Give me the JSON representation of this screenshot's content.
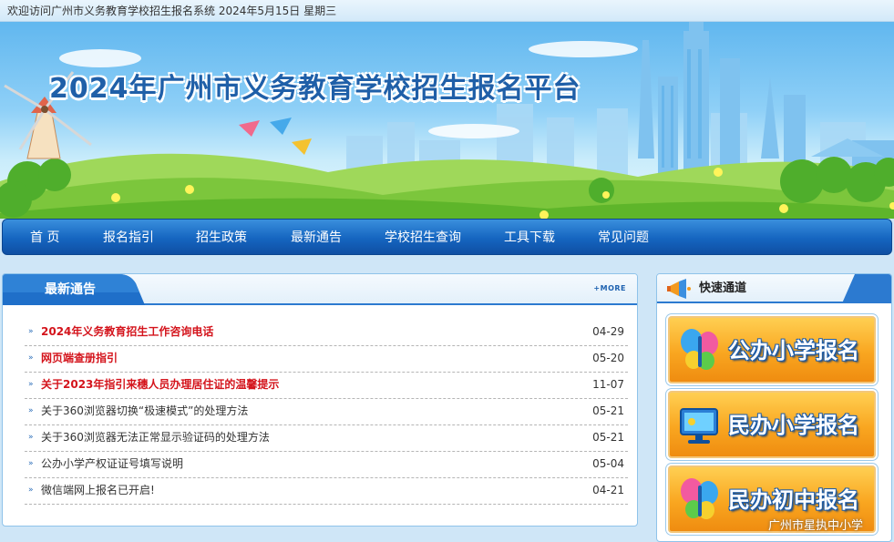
{
  "topbar": {
    "welcome": "欢迎访问广州市义务教育学校招生报名系统",
    "date": "2024年5月15日",
    "weekday": "星期三"
  },
  "banner": {
    "title": "2024年广州市义务教育学校招生报名平台"
  },
  "nav": {
    "items": [
      "首 页",
      "报名指引",
      "招生政策",
      "最新通告",
      "学校招生查询",
      "工具下载",
      "常见问题"
    ]
  },
  "news": {
    "title": "最新通告",
    "more": "+MORE",
    "items": [
      {
        "title": "2024年义务教育招生工作咨询电话",
        "date": "04-29",
        "highlight": true
      },
      {
        "title": "网页端查册指引",
        "date": "05-20",
        "highlight": true
      },
      {
        "title": "关于2023年指引来穗人员办理居住证的温馨提示",
        "date": "11-07",
        "highlight": true
      },
      {
        "title": "关于360浏览器切换“极速模式”的处理方法",
        "date": "05-21",
        "highlight": false
      },
      {
        "title": "关于360浏览器无法正常显示验证码的处理方法",
        "date": "05-21",
        "highlight": false
      },
      {
        "title": "公办小学产权证证号填写说明",
        "date": "05-04",
        "highlight": false
      },
      {
        "title": "微信端网上报名已开启!",
        "date": "04-21",
        "highlight": false
      }
    ]
  },
  "quick": {
    "title": "快速通道",
    "buttons": [
      {
        "label": "公办小学报名",
        "icon": "butterfly-icon"
      },
      {
        "label": "民办小学报名",
        "icon": "monitor-icon"
      },
      {
        "label": "民办初中报名",
        "icon": "butterfly-icon"
      }
    ]
  },
  "watermark": "广州市星执中小学",
  "colors": {
    "nav": "#1565c0",
    "highlight_text": "#d4141c",
    "quick_button": "#f9a620",
    "accent": "#2c7ad0"
  }
}
